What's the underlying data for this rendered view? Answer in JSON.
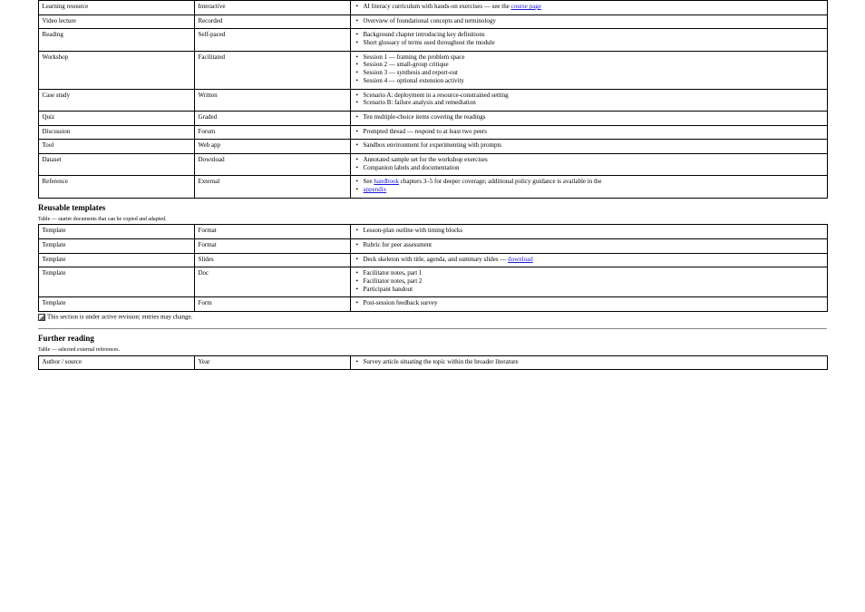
{
  "sect1": {
    "caption": "",
    "rows": [
      {
        "c1": "Learning resource",
        "c2": "Interactive",
        "c3": [
          {
            "pre": "AI literacy curriculum with hands-on exercises — see the ",
            "link": "course page",
            "post": ""
          }
        ]
      },
      {
        "c1": "Video lecture",
        "c2": "Recorded",
        "c3": [
          {
            "pre": "Overview of foundational concepts and terminology",
            "link": "",
            "post": ""
          }
        ]
      },
      {
        "c1": "Reading",
        "c2": "Self-paced",
        "c3": [
          {
            "pre": "Background chapter introducing key definitions",
            "link": "",
            "post": ""
          },
          {
            "pre": "Short glossary of terms used throughout the module",
            "link": "",
            "post": ""
          }
        ]
      },
      {
        "c1": "Workshop",
        "c2": "Facilitated",
        "c3": [
          {
            "pre": "Session 1 — framing the problem space",
            "link": "",
            "post": ""
          },
          {
            "pre": "Session 2 — small-group critique",
            "link": "",
            "post": ""
          },
          {
            "pre": "Session 3 — synthesis and report-out",
            "link": "",
            "post": ""
          },
          {
            "pre": "Session 4 — optional extension activity",
            "link": "",
            "post": ""
          }
        ]
      },
      {
        "c1": "Case study",
        "c2": "Written",
        "c3": [
          {
            "pre": "Scenario A: deployment in a resource-constrained setting",
            "link": "",
            "post": ""
          },
          {
            "pre": "Scenario B: failure analysis and remediation",
            "link": "",
            "post": ""
          }
        ]
      },
      {
        "c1": "Quiz",
        "c2": "Graded",
        "c3": [
          {
            "pre": "Ten multiple-choice items covering the readings",
            "link": "",
            "post": ""
          }
        ]
      },
      {
        "c1": "Discussion",
        "c2": "Forum",
        "c3": [
          {
            "pre": "Prompted thread — respond to at least two peers",
            "link": "",
            "post": ""
          }
        ]
      },
      {
        "c1": "Tool",
        "c2": "Web app",
        "c3": [
          {
            "pre": "Sandbox environment for experimenting with prompts",
            "link": "",
            "post": ""
          }
        ]
      },
      {
        "c1": "Dataset",
        "c2": "Download",
        "c3": [
          {
            "pre": "Annotated sample set for the workshop exercises",
            "link": "",
            "post": ""
          },
          {
            "pre": "Companion labels and documentation",
            "link": "",
            "post": ""
          }
        ]
      },
      {
        "c1": "Reference",
        "c2": "External",
        "c3": [
          {
            "pre": "See ",
            "link": "handbook",
            "post": " chapters 3–5 for deeper coverage; additional policy guidance is available in the "
          },
          {
            "link2": "appendix",
            "post2": ""
          }
        ]
      }
    ]
  },
  "sect2": {
    "title": "Reusable templates",
    "caption": "Table — starter documents that can be copied and adapted.",
    "rows": [
      {
        "c1": "Template",
        "c2": "Format",
        "c3": [
          {
            "pre": "Lesson-plan outline with timing blocks",
            "link": "",
            "post": ""
          }
        ]
      },
      {
        "c1": "Template",
        "c2": "Format",
        "c3": [
          {
            "pre": "Rubric for peer assessment",
            "link": "",
            "post": ""
          }
        ]
      },
      {
        "c1": "Template",
        "c2": "Slides",
        "c3": [
          {
            "pre": "Deck skeleton with title, agenda, and summary slides — ",
            "link": "download",
            "post": ""
          }
        ]
      },
      {
        "c1": "Template",
        "c2": "Doc",
        "c3": [
          {
            "pre": "Facilitator notes, part 1",
            "link": "",
            "post": ""
          },
          {
            "pre": "Facilitator notes, part 2",
            "link": "",
            "post": ""
          },
          {
            "pre": "Participant handout",
            "link": "",
            "post": ""
          }
        ]
      },
      {
        "c1": "Template",
        "c2": "Form",
        "c3": [
          {
            "pre": "Post-session feedback survey",
            "link": "",
            "post": ""
          }
        ]
      }
    ],
    "postnote": "This section is under active revision; entries may change."
  },
  "sect3": {
    "title": "Further reading",
    "caption": "Table — selected external references.",
    "rows": [
      {
        "c1": "Author / source",
        "c2": "Year",
        "c3": [
          {
            "pre": "Survey article situating the topic within the broader literature",
            "link": "",
            "post": ""
          }
        ]
      }
    ]
  }
}
